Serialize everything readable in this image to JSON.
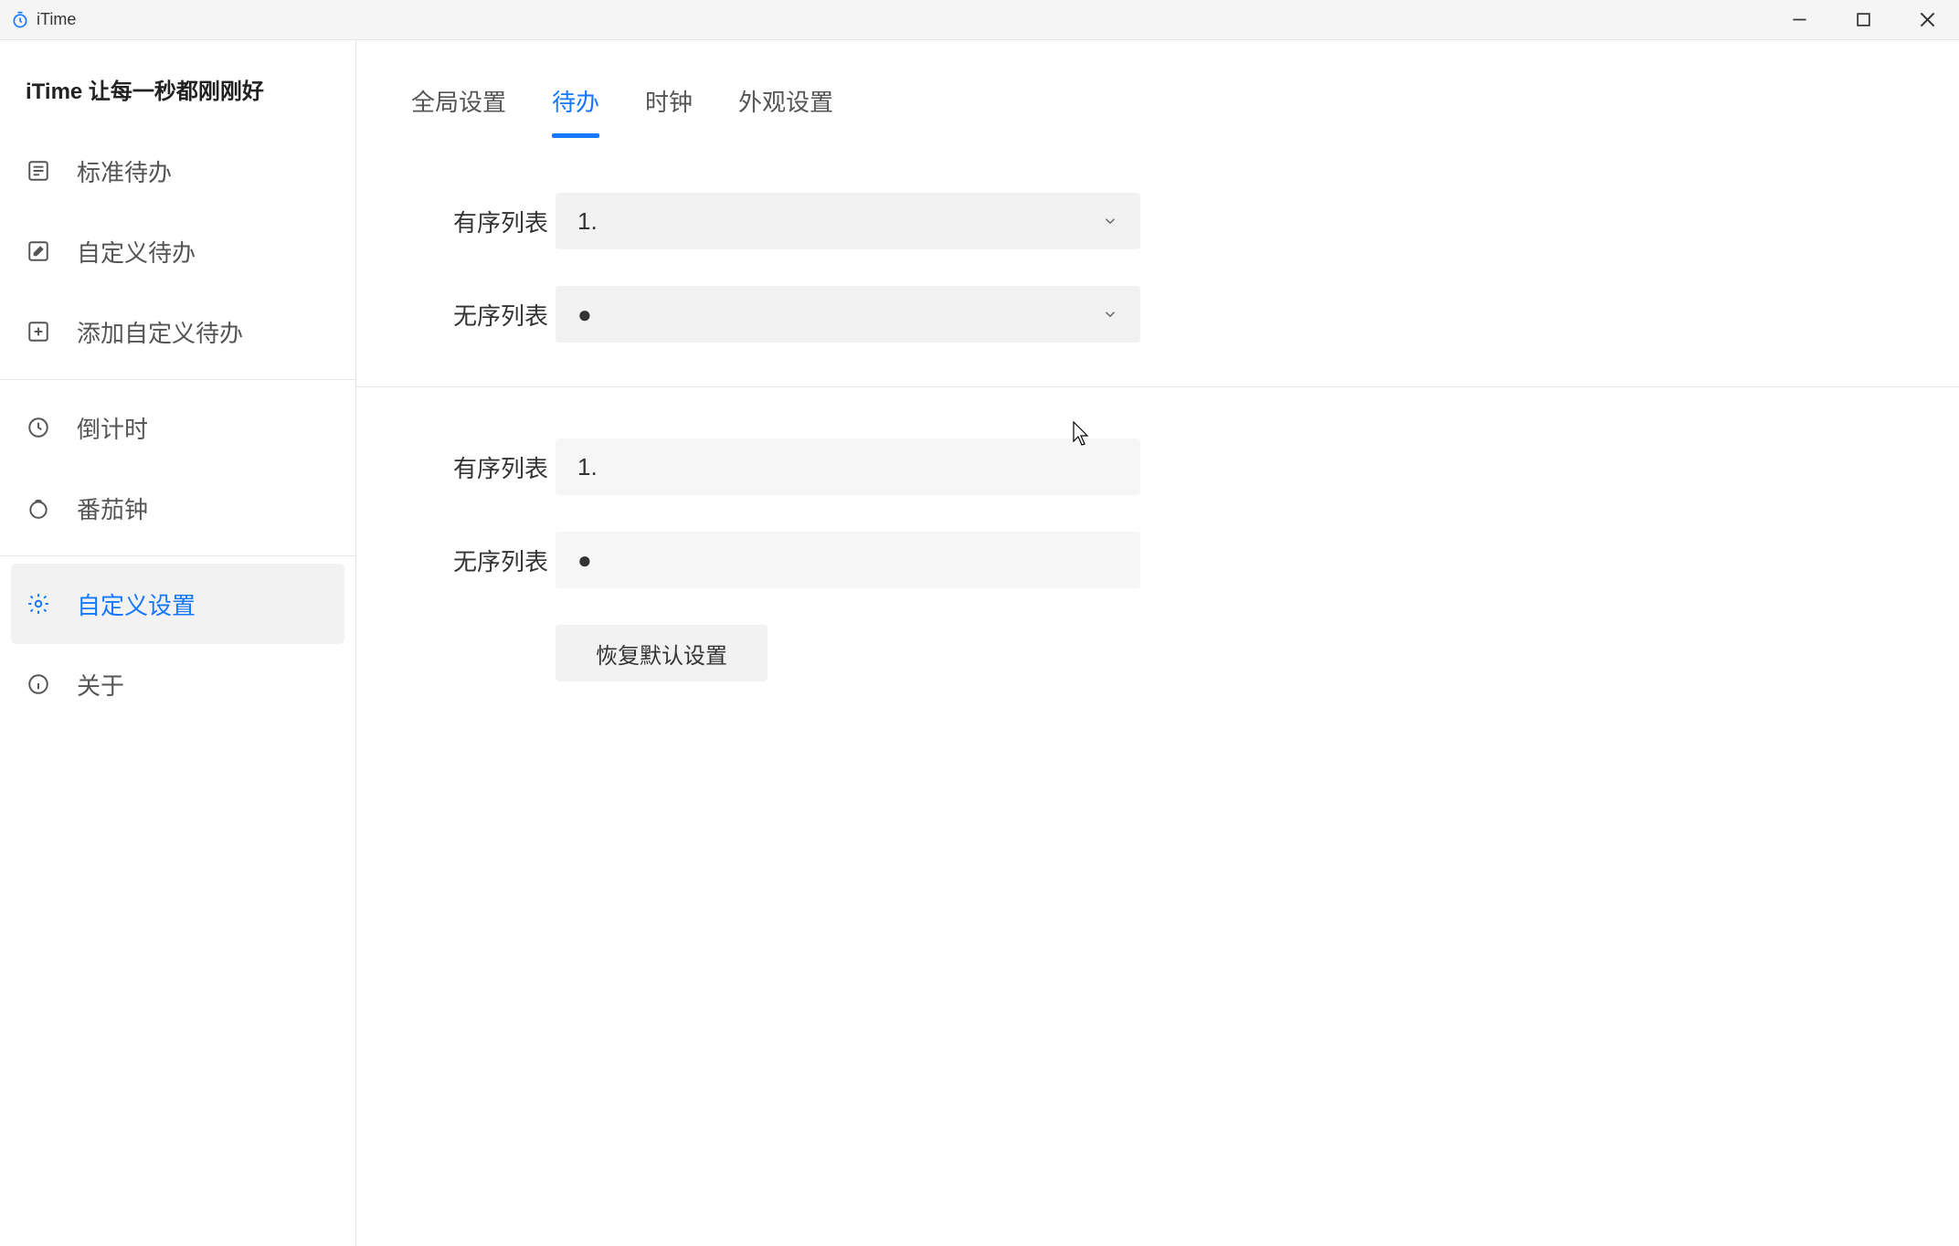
{
  "titlebar": {
    "app_name": "iTime"
  },
  "sidebar": {
    "header": "iTime 让每一秒都刚刚好",
    "groups": [
      {
        "items": [
          {
            "icon": "list-check-icon",
            "label": "标准待办"
          },
          {
            "icon": "edit-square-icon",
            "label": "自定义待办"
          },
          {
            "icon": "plus-square-icon",
            "label": "添加自定义待办"
          }
        ]
      },
      {
        "items": [
          {
            "icon": "clock-icon",
            "label": "倒计时"
          },
          {
            "icon": "tomato-icon",
            "label": "番茄钟"
          }
        ]
      },
      {
        "items": [
          {
            "icon": "gear-icon",
            "label": "自定义设置",
            "active": true
          },
          {
            "icon": "info-icon",
            "label": "关于"
          }
        ]
      }
    ]
  },
  "tabs": [
    {
      "label": "全局设置"
    },
    {
      "label": "待办",
      "active": true
    },
    {
      "label": "时钟"
    },
    {
      "label": "外观设置"
    }
  ],
  "settings": {
    "section1": {
      "ordered": {
        "label": "有序列表",
        "value": "1."
      },
      "unordered": {
        "label": "无序列表",
        "value": "●"
      }
    },
    "section2": {
      "ordered": {
        "label": "有序列表",
        "value": "1."
      },
      "unordered": {
        "label": "无序列表",
        "value": "●"
      }
    },
    "reset_button": "恢复默认设置"
  }
}
